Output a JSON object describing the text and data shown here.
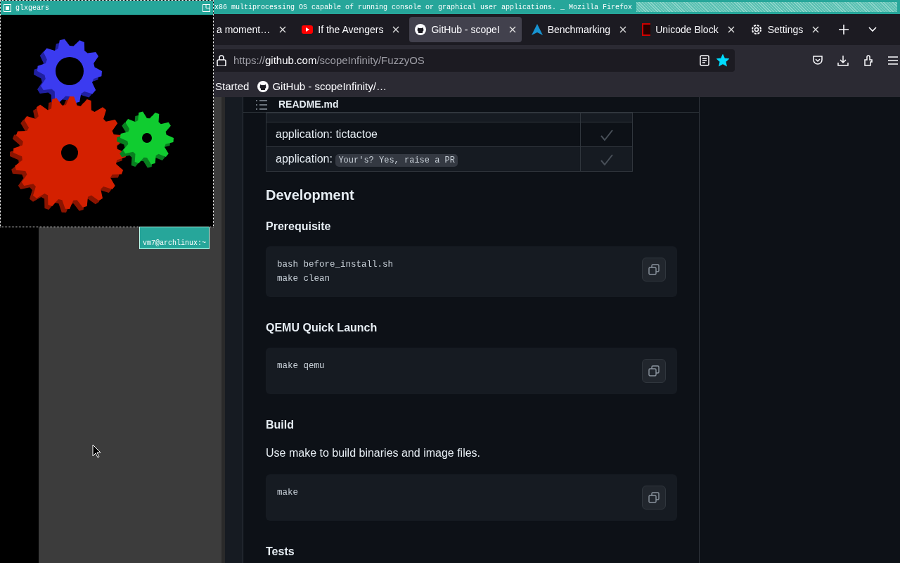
{
  "window": {
    "title": "x86 multiprocessing OS capable of running console or graphical user applications. _ Mozilla Firefox"
  },
  "tabs": [
    {
      "label": "a moment…",
      "selected": false,
      "kind": "plain"
    },
    {
      "label": "If the Avengers",
      "selected": false,
      "kind": "video"
    },
    {
      "label": "GitHub - scopeI",
      "selected": true,
      "kind": "github"
    },
    {
      "label": "Benchmarking",
      "selected": false,
      "kind": "arch"
    },
    {
      "label": "Unicode Block",
      "selected": false,
      "kind": "block"
    },
    {
      "label": "Settings",
      "selected": false,
      "kind": "gear"
    }
  ],
  "address_bar": {
    "url_prefix": "https://",
    "url_host": "github.com",
    "url_path": "/scopeInfinity/FuzzyOS",
    "bookmarked": true
  },
  "bookmarks": [
    {
      "label": "Started",
      "kind": "plain"
    },
    {
      "label": "GitHub - scopeInfinity/…",
      "kind": "github"
    }
  ],
  "readme": {
    "title": "README.md",
    "table_rows": [
      {
        "text": "application: tictactoe"
      },
      {
        "text": "application: ",
        "code": "Your's? Yes, raise a PR"
      }
    ],
    "blocks": [
      {
        "kind": "h2",
        "text": "Development"
      },
      {
        "kind": "h3",
        "text": "Prerequisite"
      },
      {
        "kind": "code",
        "lines": [
          "bash before_install.sh",
          "make clean"
        ]
      },
      {
        "kind": "h3",
        "text": "QEMU Quick Launch"
      },
      {
        "kind": "code",
        "lines": [
          "make qemu"
        ]
      },
      {
        "kind": "h3",
        "text": "Build"
      },
      {
        "kind": "p",
        "text": "Use make to build binaries and image files."
      },
      {
        "kind": "code",
        "lines": [
          "make"
        ]
      },
      {
        "kind": "h3",
        "text": "Tests"
      }
    ]
  },
  "glxgears": {
    "title": "glxgears"
  },
  "desktop_icon": {
    "label": "vm7@archlinux:~"
  }
}
